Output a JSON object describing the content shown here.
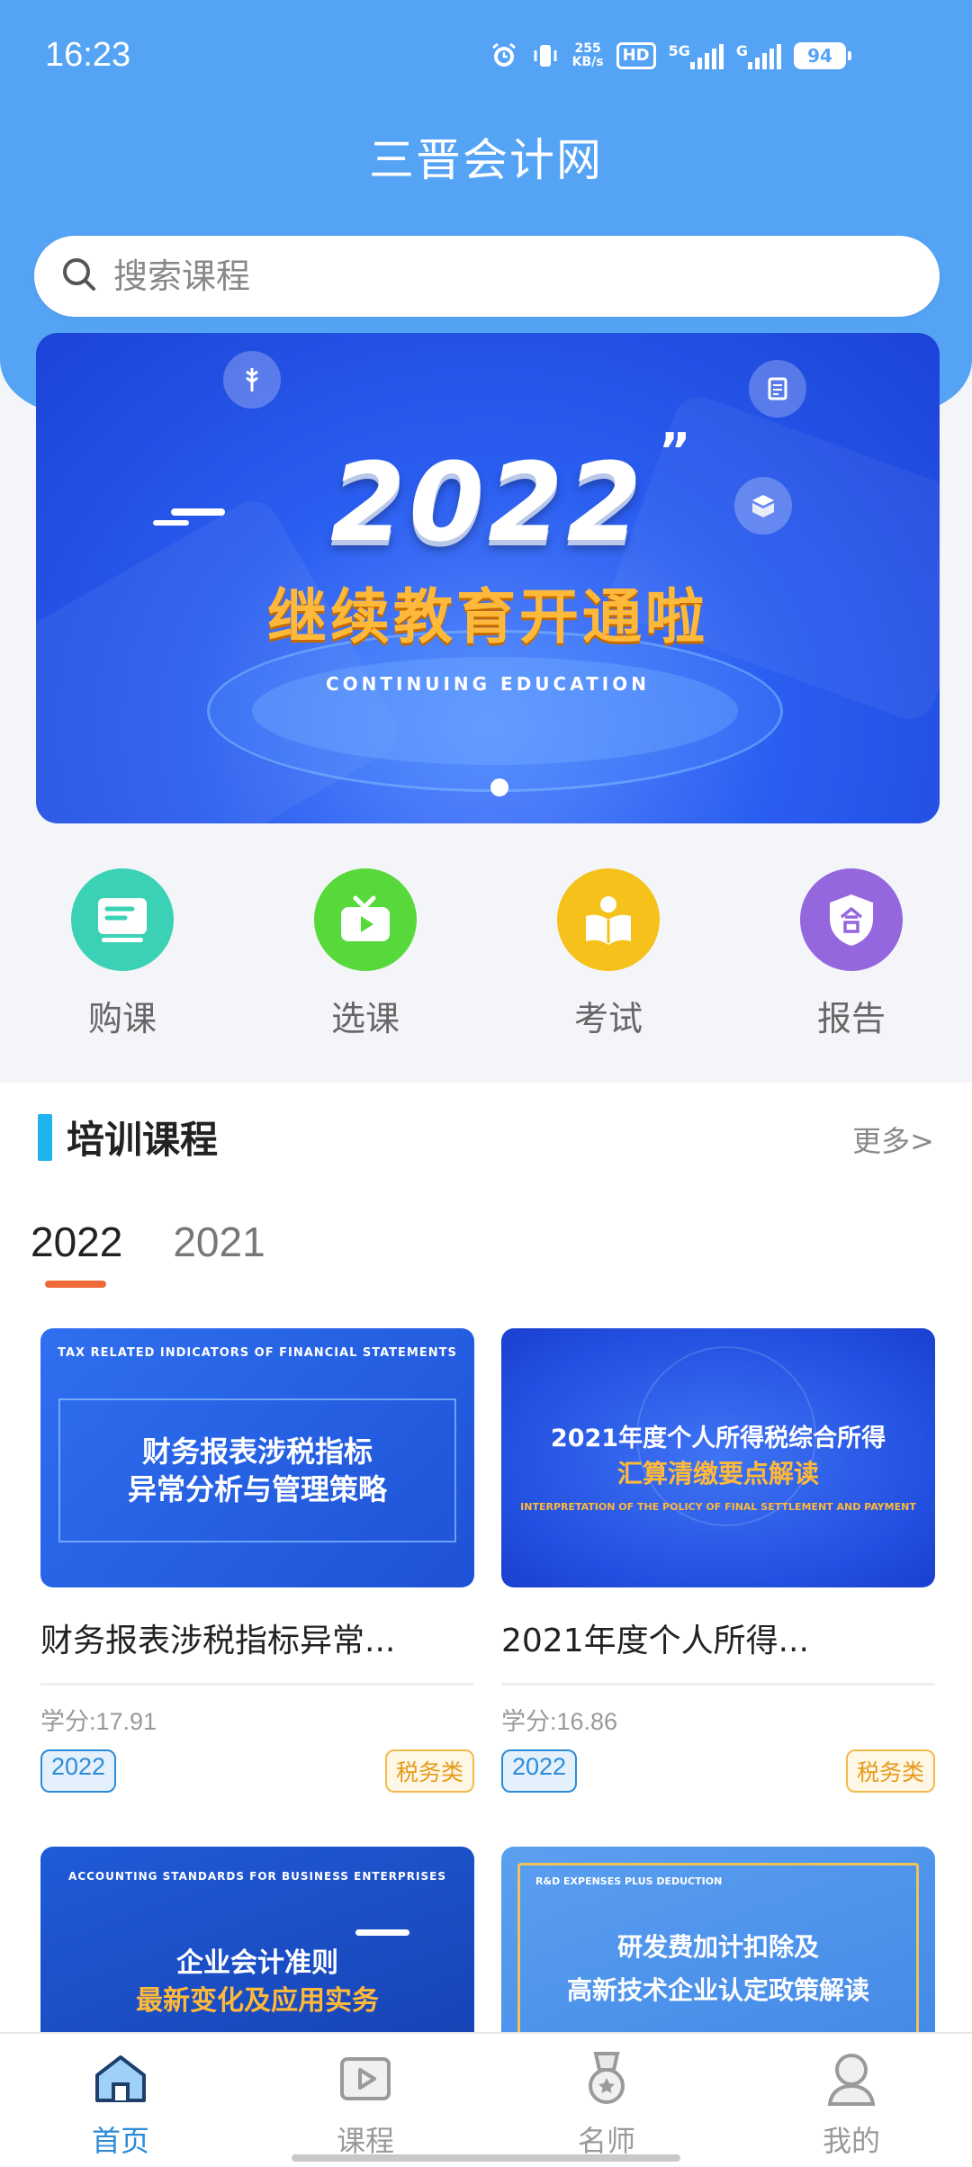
{
  "status": {
    "time": "16:23",
    "net_speed_top": "255",
    "net_speed_bottom": "KB/s",
    "hd": "HD",
    "sim1": "5G",
    "sim2": "G",
    "battery": "94"
  },
  "header": {
    "title": "三晋会计网"
  },
  "search": {
    "placeholder": "搜索课程"
  },
  "banner": {
    "year": "2022",
    "subtitle": "继续教育开通啦",
    "english": "CONTINUING EDUCATION"
  },
  "quick_actions": [
    {
      "label": "购课",
      "icon": "book-card-icon",
      "color": "#3ad1b5"
    },
    {
      "label": "选课",
      "icon": "tv-play-icon",
      "color": "#58d93b"
    },
    {
      "label": "考试",
      "icon": "reading-person-icon",
      "color": "#f5c11a"
    },
    {
      "label": "报告",
      "icon": "shield-he-icon",
      "color": "#9567de"
    }
  ],
  "training": {
    "title": "培训课程",
    "more": "更多>",
    "years": [
      "2022",
      "2021"
    ],
    "courses": [
      {
        "thumb_top": "TAX RELATED INDICATORS OF FINANCIAL STATEMENTS",
        "thumb_line1": "财务报表涉税指标",
        "thumb_line2": "异常分析与管理策略",
        "title": "财务报表涉税指标异常...",
        "credit": "学分:17.91",
        "year_tag": "2022",
        "category": "税务类"
      },
      {
        "thumb_line1": "2021年度个人所得税综合所得",
        "thumb_line2": "汇算清缴要点解读",
        "thumb_bottom": "INTERPRETATION OF THE POLICY OF FINAL SETTLEMENT AND PAYMENT",
        "title": "2021年度个人所得...",
        "credit": "学分:16.86",
        "year_tag": "2022",
        "category": "税务类"
      },
      {
        "thumb_top": "ACCOUNTING STANDARDS FOR BUSINESS ENTERPRISES",
        "thumb_line1": "企业会计准则",
        "thumb_line2": "最新变化及应用实务"
      },
      {
        "thumb_top": "R&D EXPENSES PLUS DEDUCTION",
        "thumb_line1": "研发费加计扣除及",
        "thumb_line2": "高新技术企业认定政策解读"
      }
    ]
  },
  "tabbar": {
    "items": [
      {
        "label": "首页",
        "icon": "home-icon",
        "active": true
      },
      {
        "label": "课程",
        "icon": "play-window-icon",
        "active": false
      },
      {
        "label": "名师",
        "icon": "medal-icon",
        "active": false
      },
      {
        "label": "我的",
        "icon": "user-icon",
        "active": false
      }
    ]
  },
  "colors": {
    "header_blue": "#55a3f5",
    "accent_blue": "#2d8bd6",
    "underline_orange": "#ef6a3a",
    "section_bar": "#1fb4f0"
  }
}
